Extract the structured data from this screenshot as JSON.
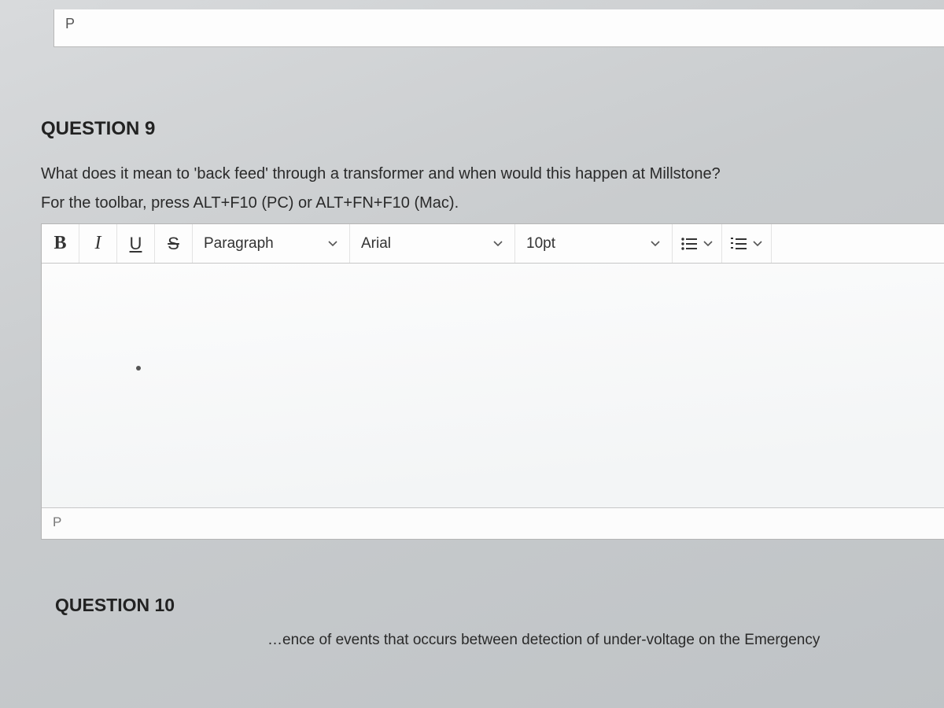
{
  "prev_status": {
    "path_label": "P"
  },
  "question9": {
    "title": "QUESTION 9",
    "prompt": "What does it mean to 'back feed' through a transformer and when would this happen at Millstone?",
    "toolbar_hint": "For the toolbar, press ALT+F10 (PC) or ALT+FN+F10 (Mac).",
    "toolbar": {
      "bold": "B",
      "italic": "I",
      "underline": "U",
      "strike": "S",
      "paragraph_style": "Paragraph",
      "font_family": "Arial",
      "font_size": "10pt"
    },
    "status_path": "P"
  },
  "question10": {
    "title": "QUESTION 10",
    "fragment": "…ence of events that occurs between detection of under-voltage on the Emergency"
  }
}
